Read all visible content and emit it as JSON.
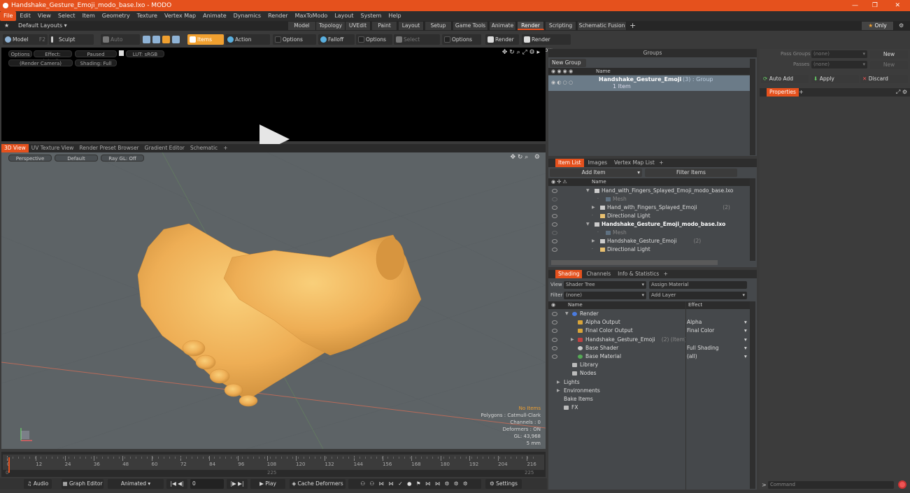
{
  "window": {
    "title": "Handshake_Gesture_Emoji_modo_base.lxo - MODO"
  },
  "menu": [
    "File",
    "Edit",
    "View",
    "Select",
    "Item",
    "Geometry",
    "Texture",
    "Vertex Map",
    "Animate",
    "Dynamics",
    "Render",
    "MaxToModo",
    "Layout",
    "System",
    "Help"
  ],
  "layout": {
    "name": "Default Layouts ▾",
    "tabs": [
      "Model",
      "Topology",
      "UVEdit",
      "Paint",
      "Layout",
      "Setup",
      "Game Tools",
      "Animate",
      "Render",
      "Scripting",
      "Schematic Fusion"
    ],
    "active_tab": "Render",
    "only_label": "Only"
  },
  "toolbar": {
    "model": "Model",
    "f2": "F2",
    "sculpt": "Sculpt",
    "auto_select": "Auto Select",
    "items": "Items",
    "action_center": "Action Center",
    "options1": "Options",
    "falloff": "Falloff",
    "options2": "Options",
    "select_through": "Select Through",
    "options3": "Options",
    "render": "Render",
    "render_window": "Render Window"
  },
  "render_view": {
    "options": "Options",
    "effect": "Effect: (Shadi...",
    "paused": "Paused",
    "lut": "LUT: sRGB",
    "camera": "(Render Camera)",
    "shading": "Shading: Full"
  },
  "view_tabs": [
    "3D View",
    "UV Texture View",
    "Render Preset Browser",
    "Gradient Editor",
    "Schematic"
  ],
  "viewport": {
    "perspective": "Perspective",
    "default": "Default",
    "raygl": "Ray GL: Off",
    "hud": {
      "no_items": "No Items",
      "polygons": "Polygons : Catmull-Clark",
      "channels": "Channels : 0",
      "deformers": "Deformers : ON",
      "gl": "GL: 43,968",
      "unit": "5 mm"
    }
  },
  "timeline": {
    "ticks": [
      "0",
      "12",
      "24",
      "36",
      "48",
      "60",
      "72",
      "84",
      "96",
      "108",
      "120",
      "132",
      "144",
      "156",
      "168",
      "180",
      "192",
      "204",
      "216"
    ],
    "sub_ticks": [
      "0",
      "225",
      "225"
    ]
  },
  "bottom": {
    "audio": "Audio",
    "graph_editor": "Graph Editor",
    "animated": "Animated",
    "frame": "0",
    "play": "Play",
    "cache": "Cache Deformers",
    "settings": "Settings"
  },
  "groups": {
    "title": "Groups",
    "new_group": "New Group",
    "name_col": "Name",
    "item_name": "Handshake_Gesture_Emoji",
    "item_count": "(3) : Group",
    "item_sub": "1 Item"
  },
  "item_list": {
    "tabs": [
      "Item List",
      "Images",
      "Vertex Map List"
    ],
    "add_item": "Add Item",
    "filter": "Filter Items",
    "name_col": "Name",
    "rows": [
      {
        "label": "Hand_with_Fingers_Splayed_Emoji_modo_base.lxo",
        "bold": false,
        "indent": 0
      },
      {
        "label": "Mesh",
        "bold": false,
        "indent": 2,
        "dim": true
      },
      {
        "label": "Hand_with_Fingers_Splayed_Emoji",
        "suffix": "(2)",
        "bold": false,
        "indent": 1
      },
      {
        "label": "Directional Light",
        "bold": false,
        "indent": 1
      },
      {
        "label": "Handshake_Gesture_Emoji_modo_base.lxo",
        "bold": true,
        "indent": 0
      },
      {
        "label": "Mesh",
        "bold": false,
        "indent": 2,
        "dim": true
      },
      {
        "label": "Handshake_Gesture_Emoji",
        "suffix": "(2)",
        "bold": false,
        "indent": 1
      },
      {
        "label": "Directional Light",
        "bold": false,
        "indent": 1
      }
    ]
  },
  "shading": {
    "tabs": [
      "Shading",
      "Channels",
      "Info & Statistics"
    ],
    "view_label": "View",
    "view_value": "Shader Tree",
    "assign": "Assign Material",
    "filter_label": "Filter",
    "filter_value": "(none)",
    "add_layer": "Add Layer",
    "name_col": "Name",
    "effect_col": "Effect",
    "rows": [
      {
        "name": "Render",
        "effect": "",
        "indent": 0
      },
      {
        "name": "Alpha Output",
        "effect": "Alpha",
        "indent": 1
      },
      {
        "name": "Final Color Output",
        "effect": "Final Color",
        "indent": 1
      },
      {
        "name": "Handshake_Gesture_Emoji",
        "suffix": "(2) (Item)",
        "effect": "",
        "indent": 1
      },
      {
        "name": "Base Shader",
        "effect": "Full Shading",
        "indent": 1
      },
      {
        "name": "Base Material",
        "effect": "(all)",
        "indent": 1
      },
      {
        "name": "Library",
        "effect": "",
        "indent": 0
      },
      {
        "name": "Nodes",
        "effect": "",
        "indent": 0
      },
      {
        "name": "Lights",
        "effect": "",
        "indent": -1
      },
      {
        "name": "Environments",
        "effect": "",
        "indent": -1
      },
      {
        "name": "Bake Items",
        "effect": "",
        "indent": -1
      },
      {
        "name": "FX",
        "effect": "",
        "indent": -1
      }
    ]
  },
  "pass": {
    "groups_label": "Pass Groups",
    "groups_value": "(none)",
    "passes_label": "Passes",
    "passes_value": "(none)",
    "new": "New",
    "new2": "New",
    "auto_add": "Auto Add",
    "apply": "Apply",
    "discard": "Discard",
    "properties": "Properties"
  },
  "command": {
    "placeholder": "Command"
  }
}
